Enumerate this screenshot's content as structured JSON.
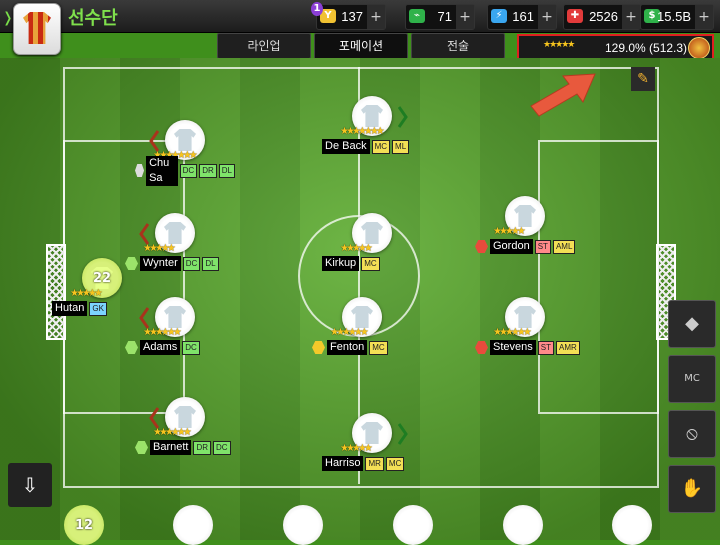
{
  "header": {
    "back_glyph": "❭",
    "title": "선수단"
  },
  "resources": [
    {
      "icon": "Y",
      "value": "137",
      "color": "#f1c232",
      "badge": "1",
      "badge_color": "#8b3fd6"
    },
    {
      "icon": "⌁",
      "value": "71",
      "color": "#2fb24a"
    },
    {
      "icon": "⚡",
      "value": "161",
      "color": "#3aa6ef"
    },
    {
      "icon": "✚",
      "value": "2526",
      "color": "#e23b3b"
    },
    {
      "icon": "$",
      "value": "15.5B",
      "color": "#2fb24a"
    }
  ],
  "plus": "+",
  "tabs": [
    {
      "label": "라인업",
      "active": false
    },
    {
      "label": "포메이션",
      "active": true
    },
    {
      "label": "전술",
      "active": false
    }
  ],
  "team_strength": {
    "stars": "★★★★★",
    "value": "129.0% (512.3)"
  },
  "players": [
    {
      "name": "Hutan",
      "number": "22",
      "positions": [
        {
          "code": "GK",
          "type": "gk"
        }
      ],
      "stars": "★★★★★",
      "role": "gk",
      "hex": "",
      "chevron": ""
    },
    {
      "name": "Chu Sa",
      "number": "",
      "positions": [
        {
          "code": "DC",
          "type": "def"
        },
        {
          "code": "DR",
          "type": "def"
        },
        {
          "code": "DL",
          "type": "def"
        }
      ],
      "stars": "★★★★★★★",
      "role": "field",
      "hex": "white",
      "chevron": "left"
    },
    {
      "name": "Wynter",
      "number": "",
      "positions": [
        {
          "code": "DC",
          "type": "def"
        },
        {
          "code": "DL",
          "type": "def"
        }
      ],
      "stars": "★★★★★",
      "role": "field",
      "hex": "green",
      "chevron": "left"
    },
    {
      "name": "Adams",
      "number": "",
      "positions": [
        {
          "code": "DC",
          "type": "def"
        }
      ],
      "stars": "★★★★★★",
      "role": "field",
      "hex": "green",
      "chevron": "left"
    },
    {
      "name": "Barnett",
      "number": "",
      "positions": [
        {
          "code": "DR",
          "type": "def"
        },
        {
          "code": "DC",
          "type": "def"
        }
      ],
      "stars": "★★★★★★",
      "role": "field",
      "hex": "green",
      "chevron": "left"
    },
    {
      "name": "De Back",
      "number": "",
      "positions": [
        {
          "code": "MC",
          "type": "mid"
        },
        {
          "code": "ML",
          "type": "mid"
        }
      ],
      "stars": "★★★★★★★",
      "role": "field",
      "hex": "",
      "chevron": "right"
    },
    {
      "name": "Kirkup",
      "number": "",
      "positions": [
        {
          "code": "MC",
          "type": "mid"
        }
      ],
      "stars": "★★★★★",
      "role": "field",
      "hex": "",
      "chevron": ""
    },
    {
      "name": "Fenton",
      "number": "",
      "positions": [
        {
          "code": "MC",
          "type": "mid"
        }
      ],
      "stars": "★★★★★★",
      "role": "field",
      "hex": "yellow",
      "chevron": ""
    },
    {
      "name": "Harriso",
      "number": "",
      "positions": [
        {
          "code": "MR",
          "type": "mid"
        },
        {
          "code": "MC",
          "type": "mid"
        }
      ],
      "stars": "★★★★★",
      "role": "field",
      "hex": "",
      "chevron": "right"
    },
    {
      "name": "Gordon",
      "number": "",
      "positions": [
        {
          "code": "ST",
          "type": "att"
        },
        {
          "code": "AML",
          "type": "mid"
        }
      ],
      "stars": "★★★★★",
      "role": "field",
      "hex": "red",
      "chevron": ""
    },
    {
      "name": "Stevens",
      "number": "",
      "positions": [
        {
          "code": "ST",
          "type": "att"
        },
        {
          "code": "AMR",
          "type": "mid"
        }
      ],
      "stars": "★★★★★★",
      "role": "field",
      "hex": "red",
      "chevron": ""
    }
  ],
  "bench": [
    {
      "number": "12",
      "role": "gk"
    },
    {
      "number": "",
      "role": "field"
    },
    {
      "number": "",
      "role": "field"
    },
    {
      "number": "",
      "role": "field"
    },
    {
      "number": "",
      "role": "field"
    },
    {
      "number": "",
      "role": "field"
    }
  ],
  "side_buttons": [
    {
      "icon": "swap-icon",
      "glyph": "◆"
    },
    {
      "icon": "mc-formation-icon",
      "glyph": "MC"
    },
    {
      "icon": "no-entry-icon",
      "glyph": "⦸"
    },
    {
      "icon": "handshake-icon",
      "glyph": "✋"
    }
  ],
  "save_glyph": "⇩",
  "edit_glyph": "✎",
  "colors": {
    "accent_green": "#7fe04c",
    "highlight_red": "#e02020",
    "star_gold": "#f7c51e"
  }
}
